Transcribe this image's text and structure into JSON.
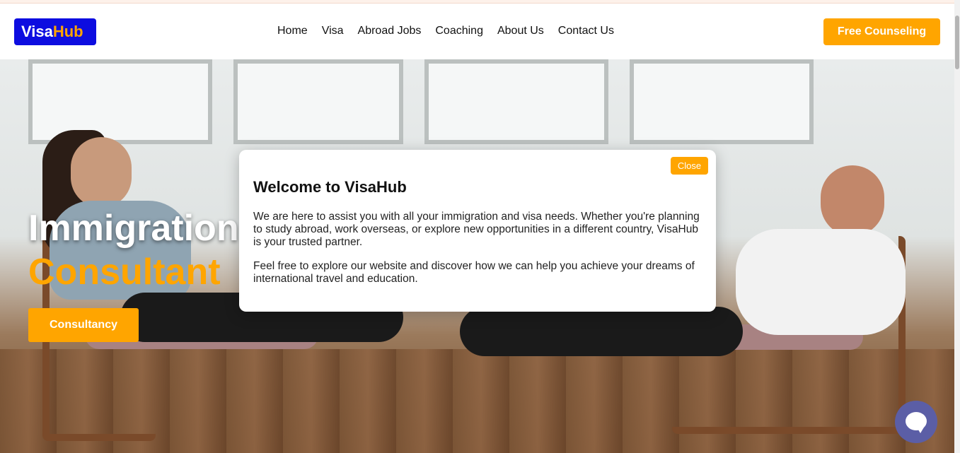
{
  "logo": {
    "part1": "Visa",
    "part2": "Hub"
  },
  "nav": {
    "items": [
      "Home",
      "Visa",
      "Abroad Jobs",
      "Coaching",
      "About Us",
      "Contact Us"
    ]
  },
  "header": {
    "cta_label": "Free Counseling"
  },
  "hero": {
    "title_line1": "Immigration",
    "title_line2": "Consultant",
    "button_label": "Consultancy"
  },
  "modal": {
    "close_label": "Close",
    "title": "Welcome to VisaHub",
    "paragraph1": "We are here to assist you with all your immigration and visa needs. Whether you're planning to study abroad, work overseas, or explore new opportunities in a different country, VisaHub is your trusted partner.",
    "paragraph2": "Feel free to explore our website and discover how we can help you achieve your dreams of international travel and education."
  },
  "chat": {
    "icon": "chat-bubble-icon"
  },
  "colors": {
    "accent": "#ffa500",
    "logo_bg": "#0d0de0",
    "chat_bg": "#5b5ea6"
  }
}
